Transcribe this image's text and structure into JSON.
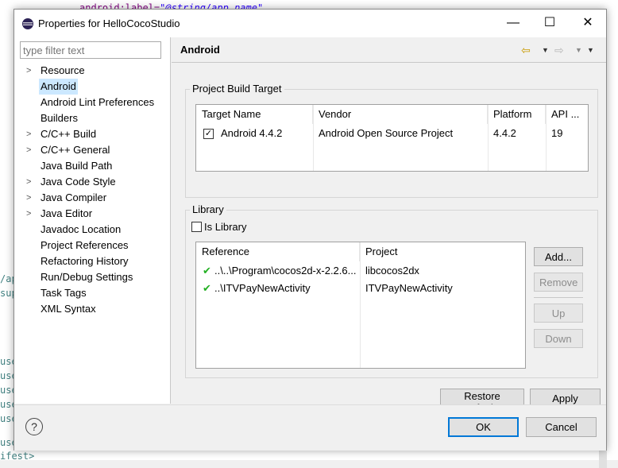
{
  "background": {
    "top_line_attr": "android:label=",
    "top_line_value": "\"@string/app_name\"",
    "left_fragments": [
      "/ap",
      "sup",
      "use",
      "use",
      "use",
      "use",
      "use",
      "use"
    ],
    "bottom_fragment": "ifest>"
  },
  "dialog": {
    "title": "Properties for HelloCocoStudio",
    "min_symbol": "—",
    "max_symbol": "☐",
    "close_symbol": "✕"
  },
  "left": {
    "filter_placeholder": "type filter text",
    "items": [
      {
        "label": "Resource",
        "expandable": true
      },
      {
        "label": "Android",
        "expandable": false,
        "selected": true
      },
      {
        "label": "Android Lint Preferences",
        "expandable": false
      },
      {
        "label": "Builders",
        "expandable": false
      },
      {
        "label": "C/C++ Build",
        "expandable": true
      },
      {
        "label": "C/C++ General",
        "expandable": true
      },
      {
        "label": "Java Build Path",
        "expandable": false
      },
      {
        "label": "Java Code Style",
        "expandable": true
      },
      {
        "label": "Java Compiler",
        "expandable": true
      },
      {
        "label": "Java Editor",
        "expandable": true
      },
      {
        "label": "Javadoc Location",
        "expandable": false
      },
      {
        "label": "Project References",
        "expandable": false
      },
      {
        "label": "Refactoring History",
        "expandable": false
      },
      {
        "label": "Run/Debug Settings",
        "expandable": false
      },
      {
        "label": "Task Tags",
        "expandable": false
      },
      {
        "label": "XML Syntax",
        "expandable": false
      }
    ]
  },
  "right": {
    "title": "Android",
    "build_target": {
      "group_label": "Project Build Target",
      "headers": [
        "Target Name",
        "Vendor",
        "Platform",
        "API ..."
      ],
      "rows": [
        {
          "checked": true,
          "name": "Android 4.4.2",
          "vendor": "Android Open Source Project",
          "platform": "4.4.2",
          "api": "19"
        }
      ]
    },
    "library": {
      "group_label": "Library",
      "is_library_label": "Is Library",
      "is_library_checked": false,
      "headers": [
        "Reference",
        "Project"
      ],
      "rows": [
        {
          "reference": "..\\..\\Program\\cocos2d-x-2.2.6...",
          "project": "libcocos2dx"
        },
        {
          "reference": "..\\ITVPayNewActivity",
          "project": "ITVPayNewActivity"
        }
      ],
      "buttons": {
        "add": "Add...",
        "remove": "Remove",
        "up": "Up",
        "down": "Down"
      }
    },
    "restore_defaults": "Restore Defaults",
    "apply": "Apply"
  },
  "footer": {
    "help": "?",
    "ok": "OK",
    "cancel": "Cancel"
  },
  "colors": {
    "selection": "#cce8ff",
    "default_button_border": "#0078d7",
    "check_green": "#22b022",
    "nav_arrow": "#c89a00"
  }
}
